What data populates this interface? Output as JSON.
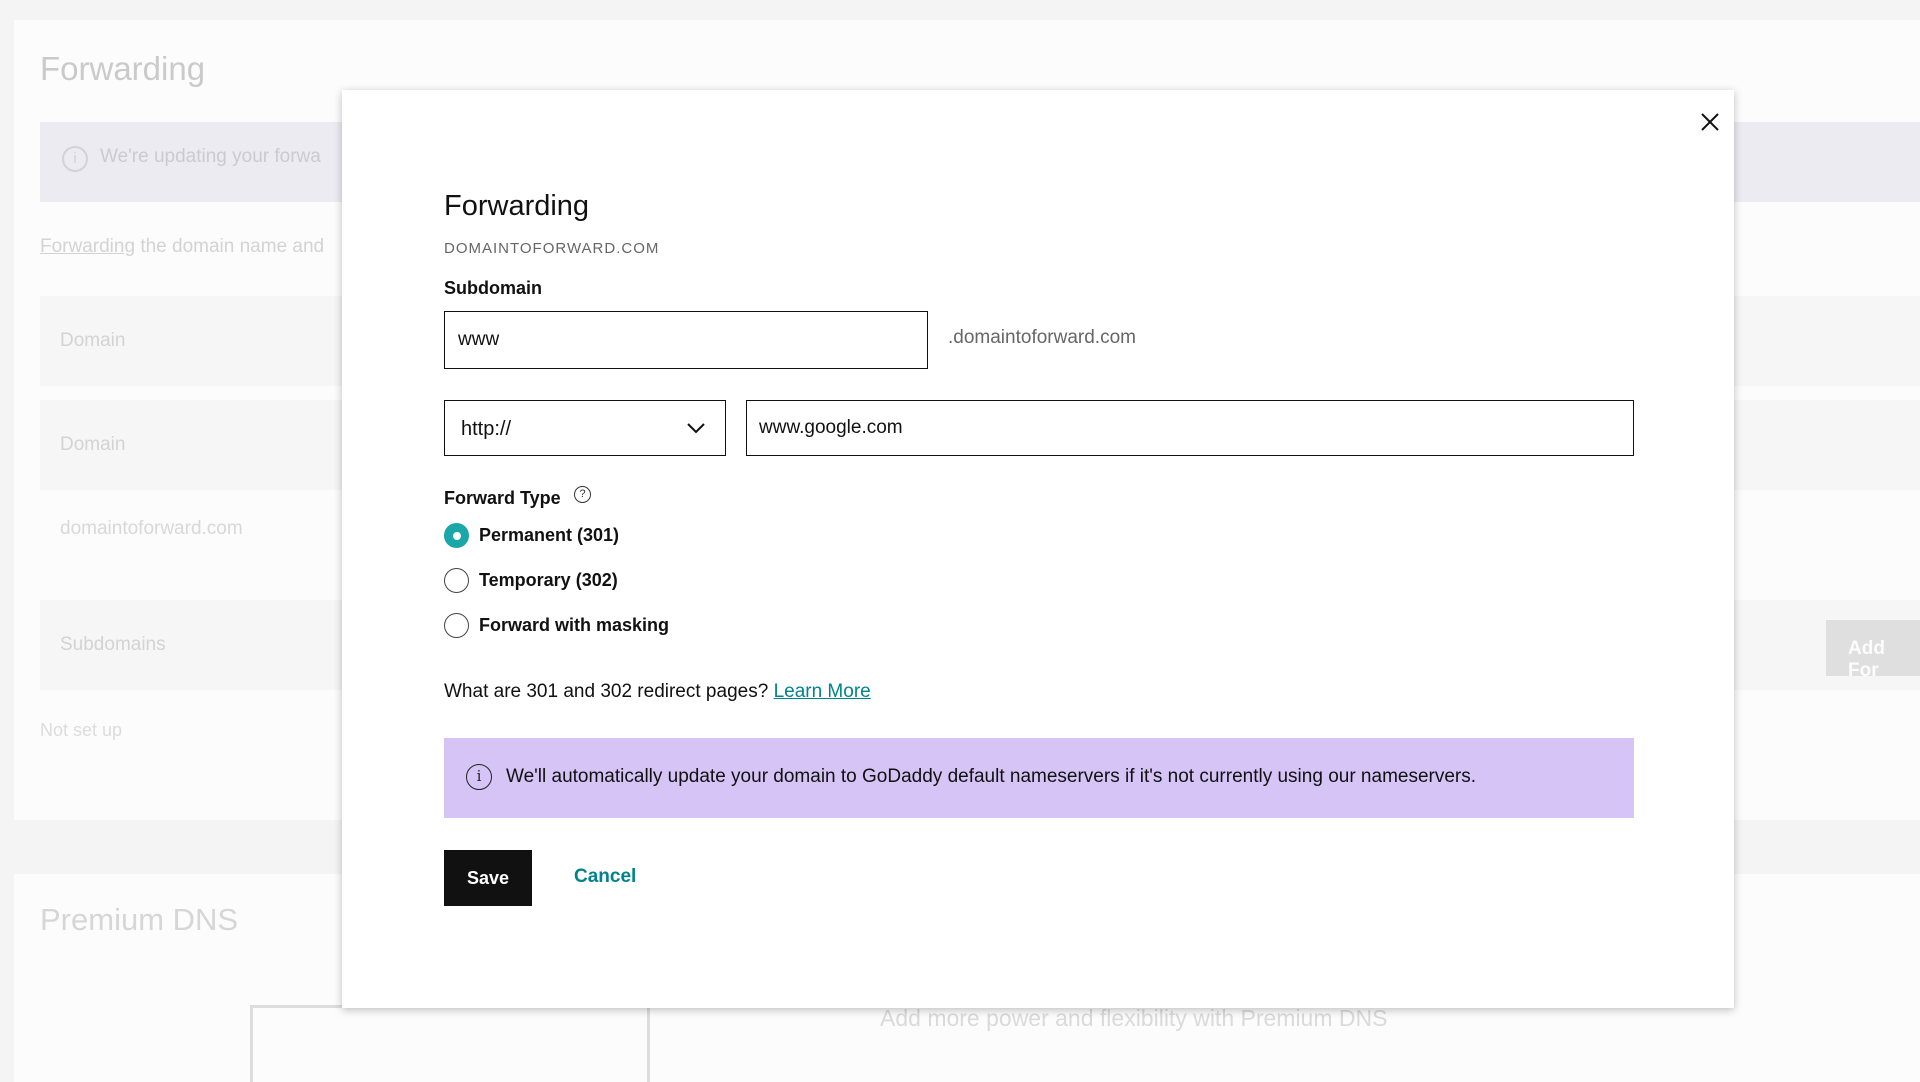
{
  "background": {
    "title": "Forwarding",
    "banner_text": "We're updating your forwa",
    "forwarding_link": "Forwarding",
    "forwarding_text": " the domain name and",
    "row_domain_1": "Domain",
    "row_domain_2": "Domain",
    "domain_value": "domaintoforward.com",
    "row_subdomains": "Subdomains",
    "not_set_up": "Not set up",
    "add_button": "Add For",
    "premium_title": "Premium DNS",
    "premium_tagline": "Add more power and flexibility with Premium DNS"
  },
  "modal": {
    "title": "Forwarding",
    "domain": "DOMAINTOFORWARD.COM",
    "subdomain_label": "Subdomain",
    "subdomain_value": "www",
    "subdomain_suffix": ".domaintoforward.com",
    "protocol_selected": "http://",
    "destination_value": "www.google.com",
    "forward_type_label": "Forward Type",
    "help_icon_glyph": "?",
    "options": [
      {
        "label": "Permanent (301)",
        "checked": true
      },
      {
        "label": "Temporary (302)",
        "checked": false
      },
      {
        "label": "Forward with masking",
        "checked": false
      }
    ],
    "redirect_question": "What are 301 and 302 redirect pages?",
    "learn_more": "Learn More",
    "notice_icon_glyph": "i",
    "notice_text": "We'll automatically update your domain to GoDaddy default nameservers if it's not currently using our nameservers.",
    "save_label": "Save",
    "cancel_label": "Cancel"
  },
  "colors": {
    "accent": "#1ba6a8",
    "link": "#00838c",
    "notice_bg": "#d6c4f6",
    "primary_button": "#111111"
  }
}
